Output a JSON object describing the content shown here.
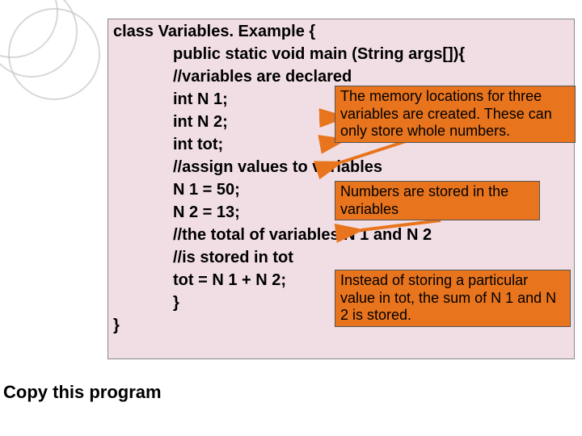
{
  "code": {
    "l1": "class Variables. Example {",
    "l2": "public static void main (String args[]){",
    "l3": "//variables are declared",
    "l4": "int N 1;",
    "l5": "int N 2;",
    "l6": "int tot;",
    "l7": "//assign values to variables",
    "l8": "N 1 = 50;",
    "l9": "N 2 = 13;",
    "l10": "//the total of variables N 1 and N 2",
    "l11": "//is stored in tot",
    "l12": "tot = N 1 + N 2;",
    "l13": "}",
    "l14": "}"
  },
  "callouts": {
    "c1": "The memory locations for three variables are created. These can only store whole numbers.",
    "c2": "Numbers are stored in the variables",
    "c3": "Instead of storing a particular value in tot, the sum of N 1 and N 2 is stored."
  },
  "instruction": "Copy this program"
}
